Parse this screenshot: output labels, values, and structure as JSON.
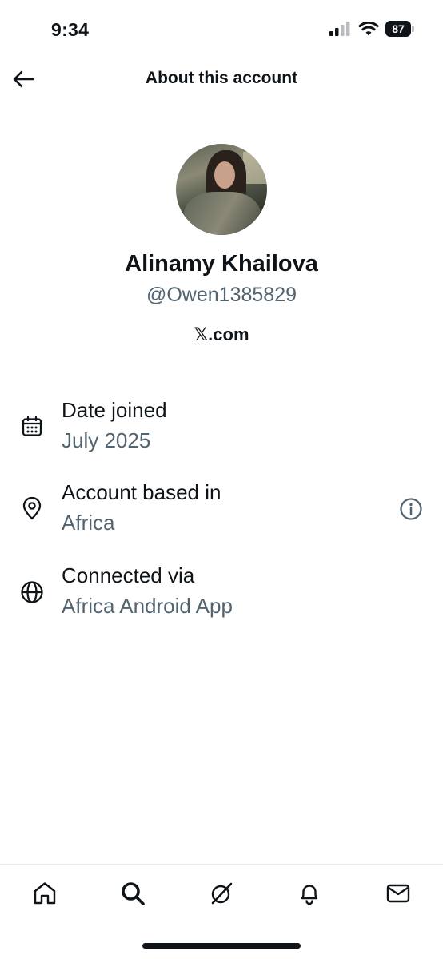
{
  "status_bar": {
    "time": "9:34",
    "battery": "87"
  },
  "header": {
    "title": "About this account"
  },
  "profile": {
    "display_name": "Alinamy Khailova",
    "handle": "@Owen1385829",
    "site": "𝕏.com"
  },
  "details": [
    {
      "label": "Date joined",
      "value": "July 2025",
      "icon": "calendar-icon"
    },
    {
      "label": "Account based in",
      "value": "Africa",
      "icon": "location-pin-icon"
    },
    {
      "label": "Connected via",
      "value": "Africa Android App",
      "icon": "globe-icon"
    }
  ],
  "tab_bar": {
    "tabs": [
      "home-icon",
      "search-icon",
      "grok-icon",
      "bell-icon",
      "mail-icon"
    ]
  },
  "colors": {
    "text": "#0f1419",
    "secondary": "#536471"
  }
}
